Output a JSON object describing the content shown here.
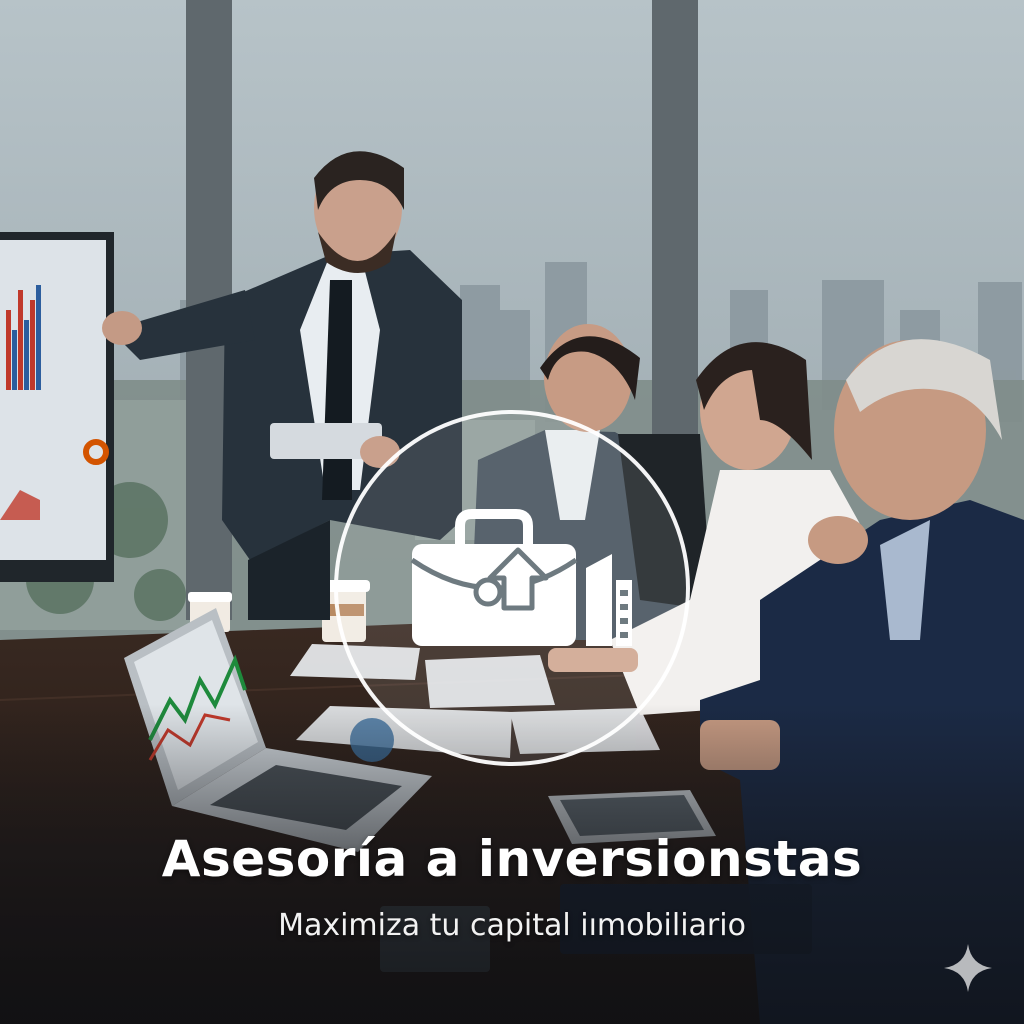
{
  "hero": {
    "title": "Asesoría a inversionstas",
    "subtitle": "Maximiza tu capital iımobiliario"
  },
  "icons": {
    "center_badge": "briefcase-growth-arrow-building-icon",
    "corner_mark": "sparkle-icon"
  },
  "colors": {
    "overlay_text": "#ffffff",
    "badge_ring": "#ffffff",
    "sky": "#a9b6bc",
    "table": "#2b1d17"
  }
}
